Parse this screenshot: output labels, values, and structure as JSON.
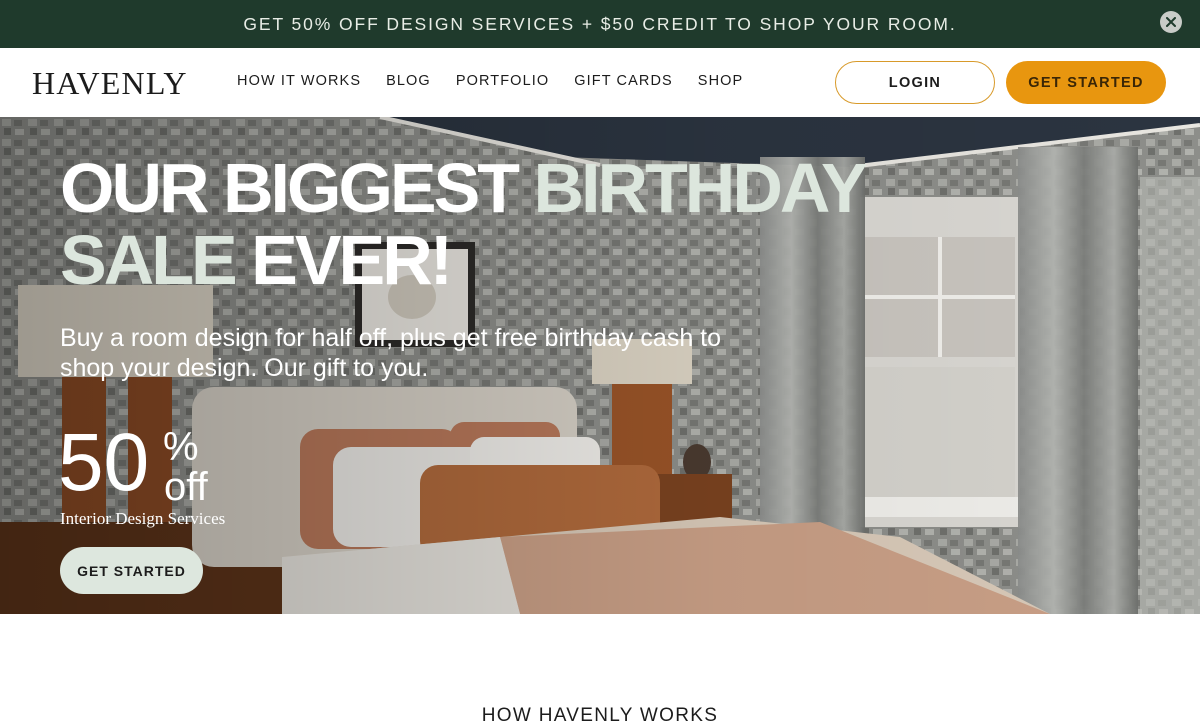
{
  "promo": {
    "text": "GET 50% OFF DESIGN SERVICES + $50 CREDIT TO SHOP YOUR ROOM."
  },
  "header": {
    "logo": "HAVENLY",
    "nav": [
      "HOW IT WORKS",
      "BLOG",
      "PORTFOLIO",
      "GIFT CARDS",
      "SHOP"
    ],
    "login": "LOGIN",
    "get_started": "GET STARTED"
  },
  "hero": {
    "title_part1": "OUR BIGGEST ",
    "title_accent1": "BIRTHDAY",
    "title_accent2": "SALE",
    "title_part2": " EVER!",
    "subtitle": "Buy a room design for half off, plus get free birthday cash to shop your design. Our gift to you.",
    "discount_number": "50",
    "discount_percent": "%",
    "discount_off": "off",
    "discount_label": "Interior Design Services",
    "cta": "GET STARTED"
  },
  "section": {
    "title": "HOW HAVENLY WORKS"
  },
  "colors": {
    "banner": "#1f3a2c",
    "accent": "#e8960f",
    "hero_button": "#dde7de"
  },
  "icons": {
    "close": "close-icon"
  }
}
